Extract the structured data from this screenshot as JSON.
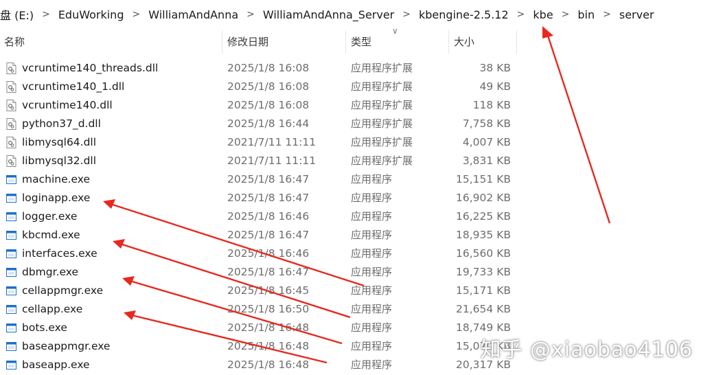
{
  "breadcrumb": {
    "items": [
      "盘 (E:)",
      "EduWorking",
      "WilliamAndAnna",
      "WilliamAndAnna_Server",
      "kbengine-2.5.12",
      "kbe",
      "bin",
      "server"
    ]
  },
  "columns": {
    "name": "名称",
    "date": "修改日期",
    "type": "类型",
    "size": "大小"
  },
  "files": [
    {
      "name": "vcruntime140_threads.dll",
      "date": "2025/1/8 16:08",
      "type": "应用程序扩展",
      "size": "38 KB",
      "icon": "dll-file-icon"
    },
    {
      "name": "vcruntime140_1.dll",
      "date": "2025/1/8 16:08",
      "type": "应用程序扩展",
      "size": "49 KB",
      "icon": "dll-file-icon"
    },
    {
      "name": "vcruntime140.dll",
      "date": "2025/1/8 16:08",
      "type": "应用程序扩展",
      "size": "118 KB",
      "icon": "dll-file-icon"
    },
    {
      "name": "python37_d.dll",
      "date": "2025/1/8 16:44",
      "type": "应用程序扩展",
      "size": "7,758 KB",
      "icon": "dll-file-icon"
    },
    {
      "name": "libmysql64.dll",
      "date": "2021/7/11 11:11",
      "type": "应用程序扩展",
      "size": "4,007 KB",
      "icon": "dll-file-icon"
    },
    {
      "name": "libmysql32.dll",
      "date": "2021/7/11 11:11",
      "type": "应用程序扩展",
      "size": "3,831 KB",
      "icon": "dll-file-icon"
    },
    {
      "name": "machine.exe",
      "date": "2025/1/8 16:47",
      "type": "应用程序",
      "size": "15,151 KB",
      "icon": "exe-file-icon"
    },
    {
      "name": "loginapp.exe",
      "date": "2025/1/8 16:47",
      "type": "应用程序",
      "size": "16,902 KB",
      "icon": "exe-file-icon"
    },
    {
      "name": "logger.exe",
      "date": "2025/1/8 16:46",
      "type": "应用程序",
      "size": "16,225 KB",
      "icon": "exe-file-icon"
    },
    {
      "name": "kbcmd.exe",
      "date": "2025/1/8 16:47",
      "type": "应用程序",
      "size": "18,935 KB",
      "icon": "exe-file-icon"
    },
    {
      "name": "interfaces.exe",
      "date": "2025/1/8 16:46",
      "type": "应用程序",
      "size": "16,560 KB",
      "icon": "exe-file-icon"
    },
    {
      "name": "dbmgr.exe",
      "date": "2025/1/8 16:47",
      "type": "应用程序",
      "size": "19,733 KB",
      "icon": "exe-file-icon"
    },
    {
      "name": "cellappmgr.exe",
      "date": "2025/1/8 16:45",
      "type": "应用程序",
      "size": "15,171 KB",
      "icon": "exe-file-icon"
    },
    {
      "name": "cellapp.exe",
      "date": "2025/1/8 16:50",
      "type": "应用程序",
      "size": "21,654 KB",
      "icon": "exe-file-icon"
    },
    {
      "name": "bots.exe",
      "date": "2025/1/8 16:48",
      "type": "应用程序",
      "size": "18,749 KB",
      "icon": "exe-file-icon"
    },
    {
      "name": "baseappmgr.exe",
      "date": "2025/1/8 16:48",
      "type": "应用程序",
      "size": "15,070 KB",
      "icon": "exe-file-icon"
    },
    {
      "name": "baseapp.exe",
      "date": "2025/1/8 16:48",
      "type": "应用程序",
      "size": "20,317 KB",
      "icon": "exe-file-icon"
    }
  ],
  "watermark": "知乎 @xiaobao4106",
  "colors": {
    "annotation_arrow": "#e8281e",
    "exe_icon_blue": "#1f6fc9"
  }
}
